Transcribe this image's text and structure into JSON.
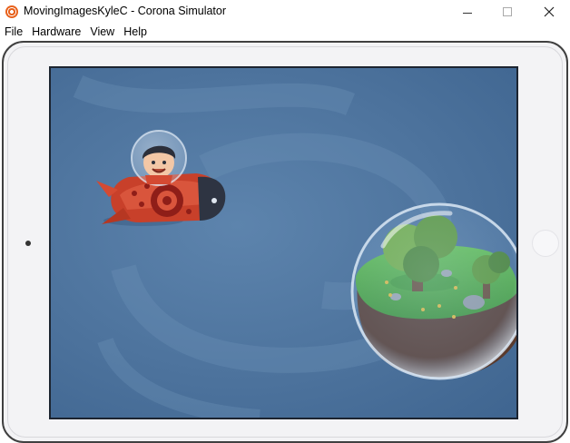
{
  "window": {
    "title": "MovingImagesKyleC - Corona Simulator",
    "app_icon": "corona-logo-icon",
    "controls": [
      "minimize-icon",
      "maximize-icon",
      "close-icon"
    ]
  },
  "menu": {
    "items": [
      "File",
      "Hardware",
      "View",
      "Help"
    ]
  },
  "device": {
    "frame_color": "#f3f3f5",
    "screen_background": "#4d739d",
    "sprites": [
      "rocket-astronaut",
      "floating-island-bubble"
    ]
  }
}
